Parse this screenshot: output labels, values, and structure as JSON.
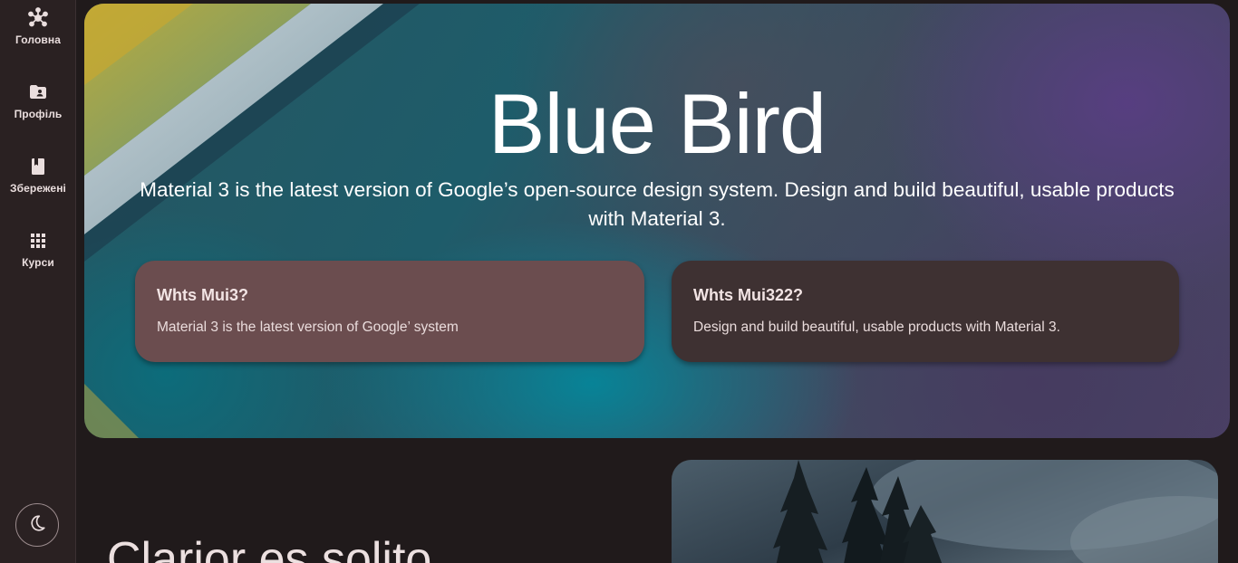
{
  "nav": {
    "items": [
      {
        "label": "Головна",
        "icon": "hub-icon"
      },
      {
        "label": "Профіль",
        "icon": "folder-account-icon"
      },
      {
        "label": "Збережені",
        "icon": "bookmark-book-icon"
      },
      {
        "label": "Курси",
        "icon": "apps-grid-icon"
      }
    ],
    "theme_toggle_icon": "moon-icon"
  },
  "hero": {
    "title": "Blue Bird",
    "subtitle": "Material 3 is the latest version of Google’s open-source design system. Design and build beautiful, usable products with Material 3.",
    "cards": [
      {
        "title": "Whts Mui3?",
        "text": "Material 3 is the latest version of Google’ system"
      },
      {
        "title": "Whts Mui322?",
        "text": "Design and build beautiful, usable products with Material 3."
      }
    ]
  },
  "section": {
    "heading": "Clarior es solito"
  },
  "colors": {
    "background": "#201a1b",
    "rail": "#2a2122",
    "card_primary": "#6b4d4f",
    "card_secondary": "#3e3132"
  }
}
